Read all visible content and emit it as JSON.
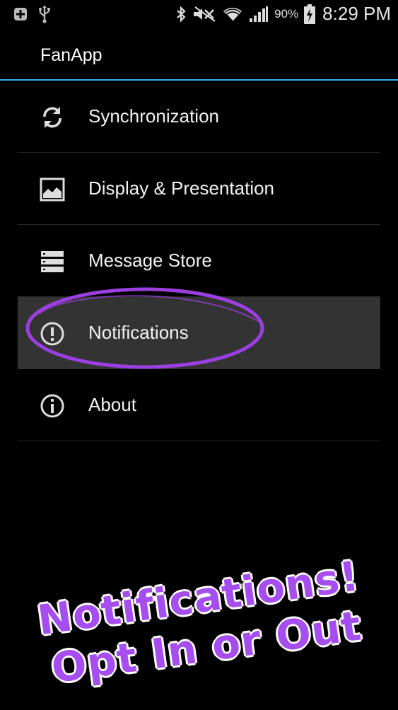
{
  "status_bar": {
    "battery_percent": "90%",
    "time": "8:29 PM",
    "icons": [
      "notification-plus-icon",
      "usb-icon",
      "bluetooth-icon",
      "mute-icon",
      "wifi-icon",
      "signal-icon",
      "battery-charging-icon"
    ]
  },
  "action_bar": {
    "title": "FanApp",
    "accent_color": "#33b5e5"
  },
  "menu": {
    "items": [
      {
        "label": "Synchronization",
        "icon": "sync-icon"
      },
      {
        "label": "Display & Presentation",
        "icon": "image-icon"
      },
      {
        "label": "Message Store",
        "icon": "storage-icon"
      },
      {
        "label": "Notifications",
        "icon": "alert-icon",
        "selected": true
      },
      {
        "label": "About",
        "icon": "info-icon"
      }
    ]
  },
  "overlay": {
    "ring_color": "#9b3fe0",
    "promo_line_1": "Notifications!",
    "promo_line_2": "Opt  In or Out"
  }
}
